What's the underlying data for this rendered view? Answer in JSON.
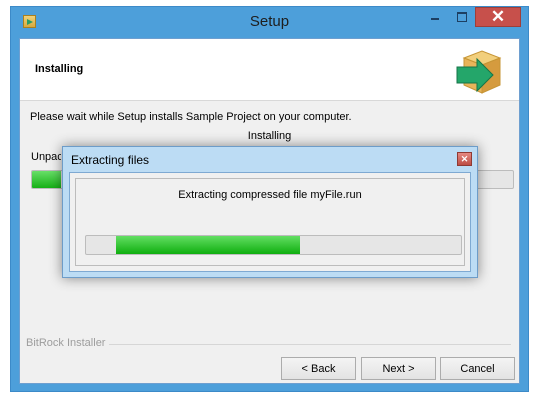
{
  "window": {
    "title": "Setup",
    "controls": {
      "close_glyph": "✕"
    }
  },
  "header": {
    "title": "Installing",
    "icon": "package-arrow-icon"
  },
  "body": {
    "instructions": "Please wait while Setup installs Sample Project on your computer.",
    "status": "Installing",
    "unpack_label": "Unpacking files",
    "progress": 0.06
  },
  "footer": {
    "branding": "BitRock Installer",
    "buttons": {
      "back": "< Back",
      "next": "Next >",
      "cancel": "Cancel"
    }
  },
  "dialog": {
    "title": "Extracting files",
    "message": "Extracting compressed file myFile.run",
    "close_glyph": "✕",
    "progress_start": 0.08,
    "progress_end": 0.57
  },
  "colors": {
    "accent": "#4d9fda",
    "progress": "#16b016",
    "close": "#c7504b"
  }
}
